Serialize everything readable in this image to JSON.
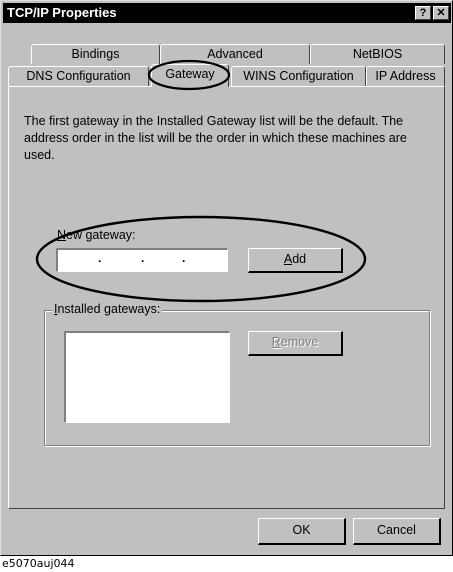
{
  "window": {
    "title": "TCP/IP Properties",
    "help_glyph": "?",
    "close_glyph": "✕"
  },
  "tabs": {
    "row1": [
      "Bindings",
      "Advanced",
      "NetBIOS"
    ],
    "row2": [
      "DNS Configuration",
      "Gateway",
      "WINS Configuration",
      "IP Address"
    ],
    "active": "Gateway"
  },
  "gateway": {
    "description": "The first gateway in the Installed Gateway list will be the default. The address order in the list will be the order in which these machines are used.",
    "new_gateway_mnemonic": "N",
    "new_gateway_rest": "ew gateway:",
    "ip_dots": [
      ".",
      ".",
      "."
    ],
    "add_mnemonic": "A",
    "add_rest": "dd",
    "installed_mnemonic": "I",
    "installed_rest": "nstalled gateways:",
    "remove_mnemonic": "R",
    "remove_rest": "emove"
  },
  "footer": {
    "ok_label": "OK",
    "cancel_label": "Cancel"
  },
  "figure_caption": "e5070auj044"
}
